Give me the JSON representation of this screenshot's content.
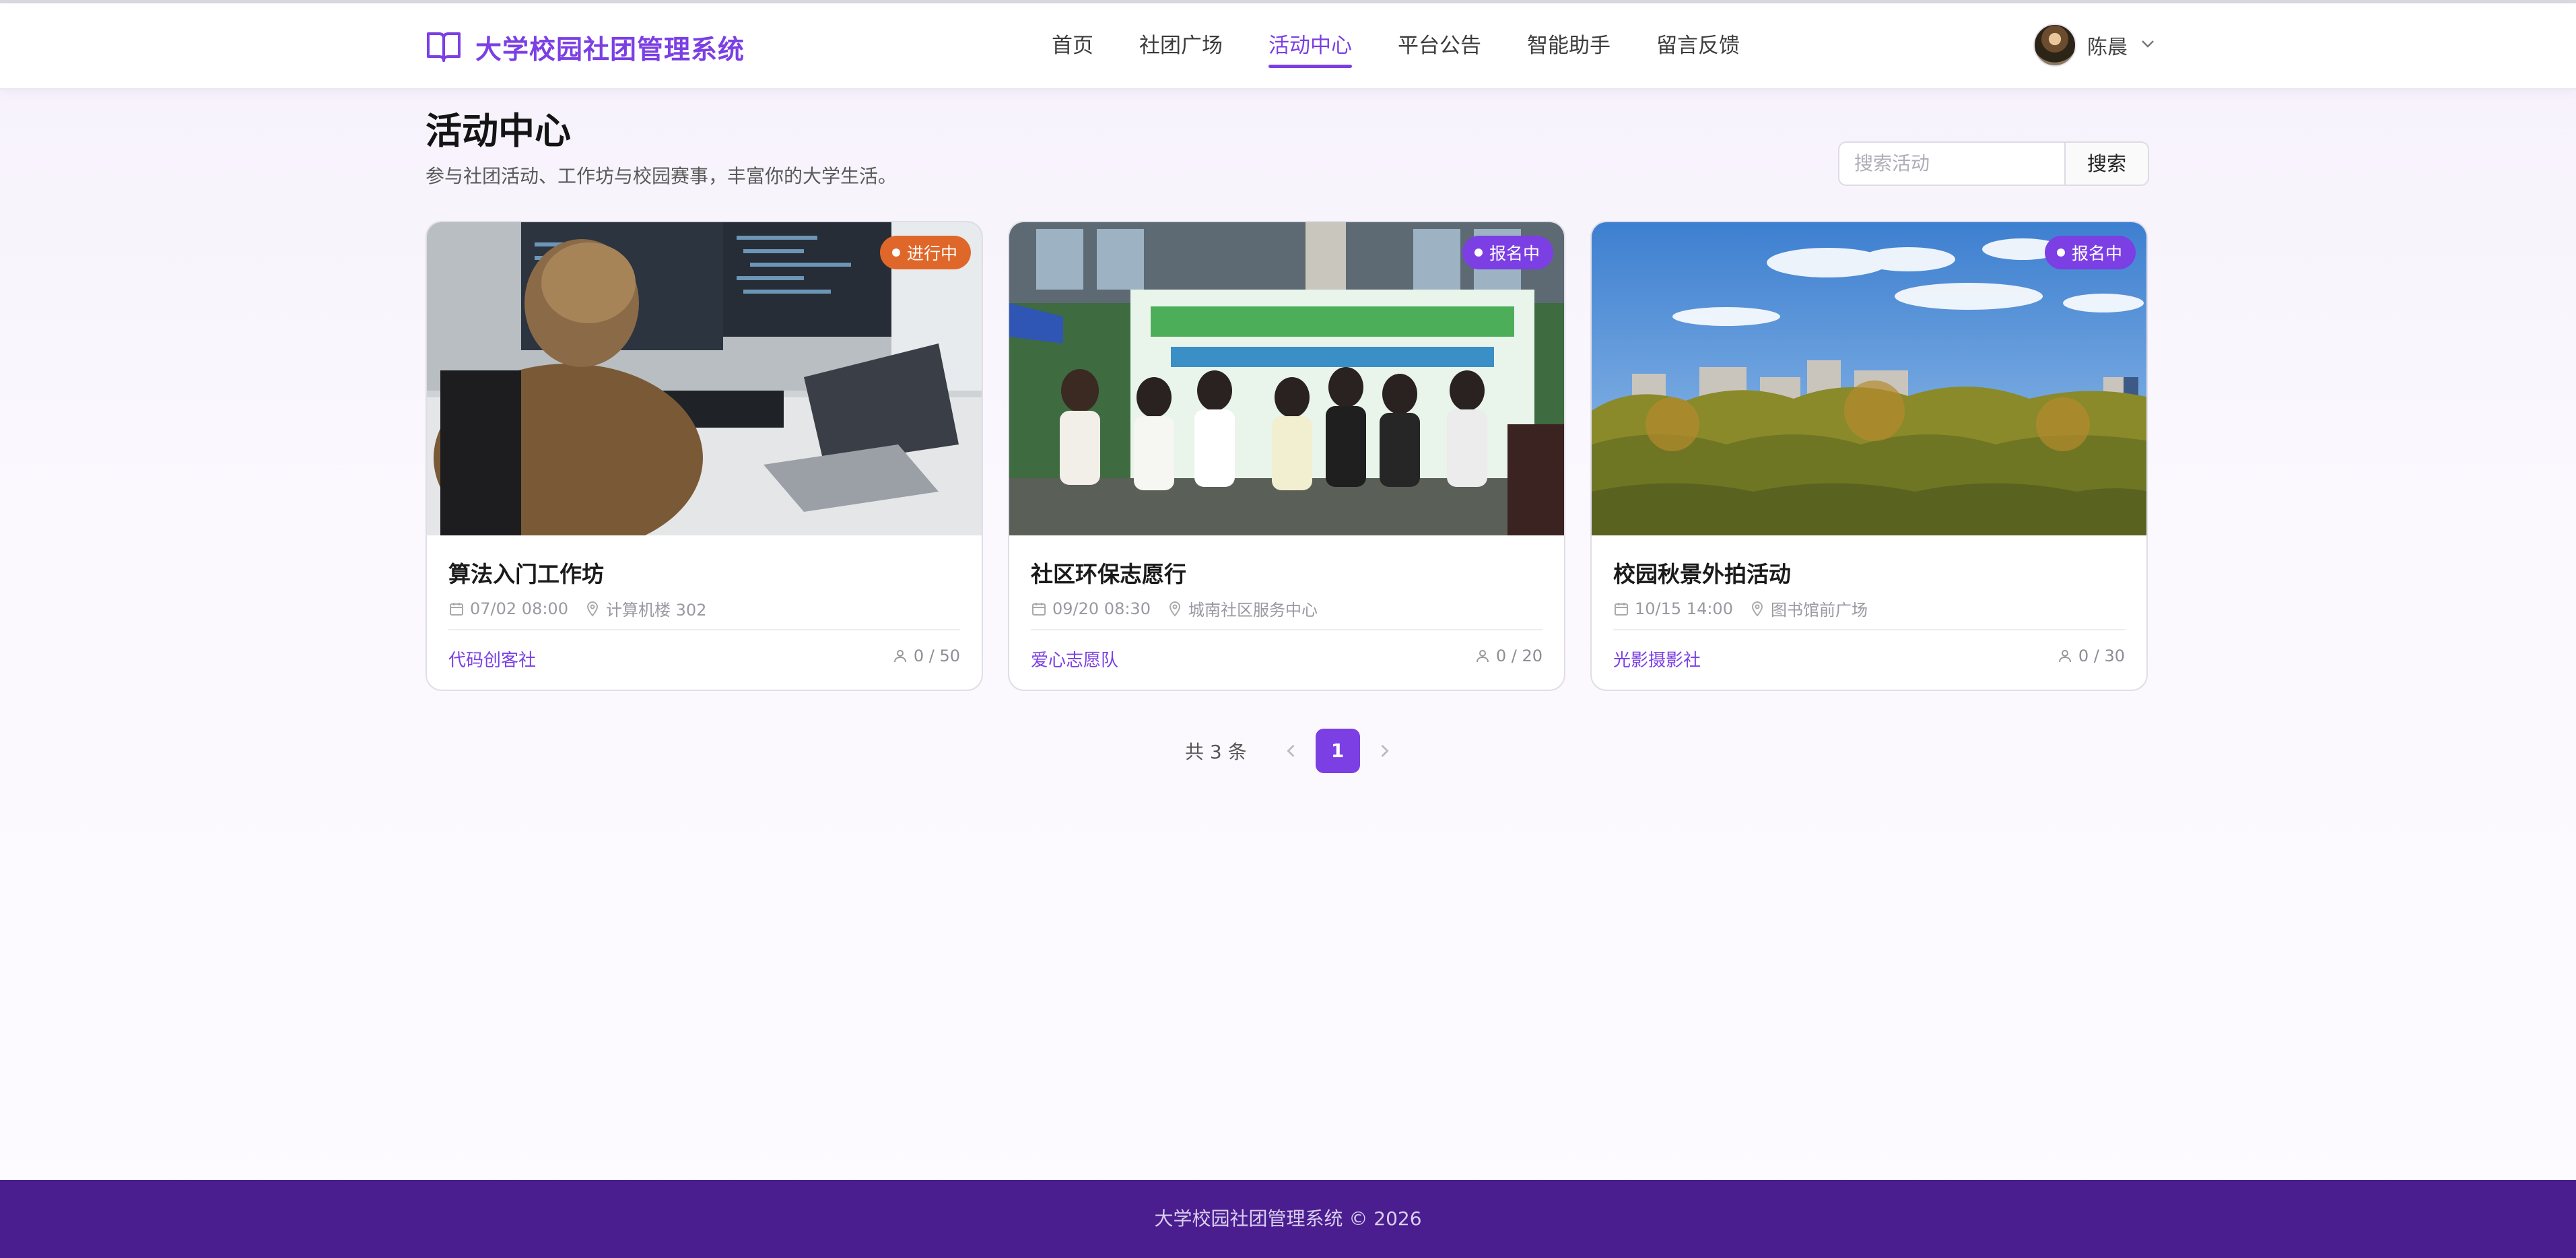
{
  "header": {
    "brand_title": "大学校园社团管理系统",
    "nav": [
      "首页",
      "社团广场",
      "活动中心",
      "平台公告",
      "智能助手",
      "留言反馈"
    ],
    "active_nav": "活动中心",
    "user_name": "陈晨"
  },
  "page": {
    "title": "活动中心",
    "subtitle": "参与社团活动、工作坊与校园赛事，丰富你的大学生活。"
  },
  "search": {
    "placeholder": "搜索活动",
    "button": "搜索"
  },
  "activities": [
    {
      "title": "算法入门工作坊",
      "time": "07/02 08:00",
      "location": "计算机楼 302",
      "club": "代码创客社",
      "quota": "0 / 50",
      "status": "进行中",
      "status_color": "#e0672a",
      "image": "person coding at multiple monitors"
    },
    {
      "title": "社区环保志愿行",
      "time": "09/20 08:30",
      "location": "城南社区服务中心",
      "club": "爱心志愿队",
      "quota": "0 / 20",
      "status": "报名中",
      "status_color": "#7b3fe4",
      "image": "volunteers in front of banner"
    },
    {
      "title": "校园秋景外拍活动",
      "time": "10/15 14:00",
      "location": "图书馆前广场",
      "club": "光影摄影社",
      "quota": "0 / 30",
      "status": "报名中",
      "status_color": "#7b3fe4",
      "image": "autumn trees under blue sky"
    }
  ],
  "pagination": {
    "total": "共 3 条",
    "current": "1"
  },
  "footer": {
    "text": "大学校园社团管理系统 © 2026"
  },
  "colors": {
    "accent": "#7b3fe4",
    "footer_bg": "#4a1e8f",
    "ongoing": "#e0672a"
  }
}
